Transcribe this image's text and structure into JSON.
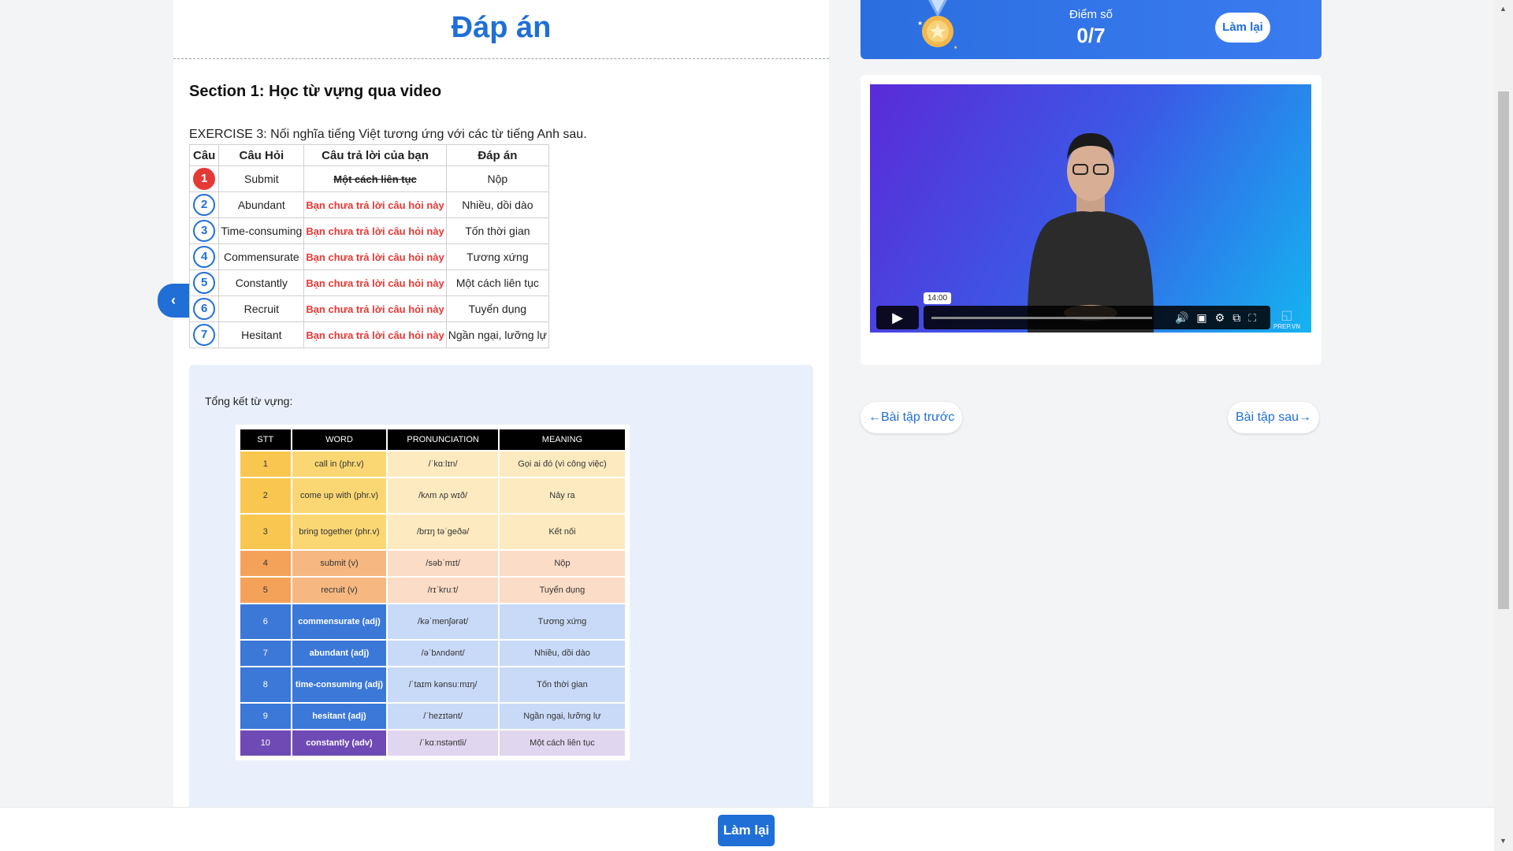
{
  "header": {
    "title": "Đáp án"
  },
  "section": {
    "title": "Section 1: Học từ vựng qua video"
  },
  "exercise": {
    "instruction": "EXERCISE 3: Nối nghĩa tiếng Việt tương ứng với các từ tiếng Anh sau.",
    "columns": [
      "Câu",
      "Câu Hỏi",
      "Câu trả lời của bạn",
      "Đáp án"
    ],
    "rows": [
      {
        "num": "1",
        "question": "Submit",
        "answer": "Một cách liên tục",
        "correct": "Nộp",
        "status": "wrong"
      },
      {
        "num": "2",
        "question": "Abundant",
        "answer": "Bạn chưa trả lời câu hỏi này",
        "correct": "Nhiều, dồi dào",
        "status": "unanswered"
      },
      {
        "num": "3",
        "question": "Time-consuming",
        "answer": "Bạn chưa trả lời câu hỏi này",
        "correct": "Tốn thời gian",
        "status": "unanswered"
      },
      {
        "num": "4",
        "question": "Commensurate",
        "answer": "Bạn chưa trả lời câu hỏi này",
        "correct": "Tương xứng",
        "status": "unanswered"
      },
      {
        "num": "5",
        "question": "Constantly",
        "answer": "Bạn chưa trả lời câu hỏi này",
        "correct": "Một cách liên tục",
        "status": "unanswered"
      },
      {
        "num": "6",
        "question": "Recruit",
        "answer": "Bạn chưa trả lời câu hỏi này",
        "correct": "Tuyển dụng",
        "status": "unanswered"
      },
      {
        "num": "7",
        "question": "Hesitant",
        "answer": "Bạn chưa trả lời câu hỏi này",
        "correct": "Ngần ngại, lưỡng lự",
        "status": "unanswered"
      }
    ]
  },
  "summary": {
    "title": "Tổng kết từ vựng:",
    "columns": [
      "STT",
      "WORD",
      "PRONUNCIATION",
      "MEANING"
    ],
    "rows": [
      {
        "stt": "1",
        "word": "call in (phr.v)",
        "pron": "/ˈkɑːlɪn/",
        "meaning": "Gọi ai đó (vì công việc)",
        "group": "yellow"
      },
      {
        "stt": "2",
        "word": "come up with (phr.v)",
        "pron": "/kʌm ʌp wɪð/",
        "meaning": "Nảy ra",
        "group": "yellow"
      },
      {
        "stt": "3",
        "word": "bring together (phr.v)",
        "pron": "/brɪŋ təˈgeðə/",
        "meaning": "Kết nối",
        "group": "yellow"
      },
      {
        "stt": "4",
        "word": "submit (v)",
        "pron": "/səbˈmɪt/",
        "meaning": "Nộp",
        "group": "orange"
      },
      {
        "stt": "5",
        "word": "recruit (v)",
        "pron": "/rɪˈkruːt/",
        "meaning": "Tuyển dụng",
        "group": "orange"
      },
      {
        "stt": "6",
        "word": "commensurate (adj)",
        "pron": "/kəˈmenʃərət/",
        "meaning": "Tương xứng",
        "group": "blue"
      },
      {
        "stt": "7",
        "word": "abundant (adj)",
        "pron": "/əˈbʌndənt/",
        "meaning": "Nhiều, dồi dào",
        "group": "blue"
      },
      {
        "stt": "8",
        "word": "time-consuming (adj)",
        "pron": "/ˈtaɪm kənsuːmɪŋ/",
        "meaning": "Tốn thời gian",
        "group": "blue"
      },
      {
        "stt": "9",
        "word": "hesitant (adj)",
        "pron": "/ˈhezɪtənt/",
        "meaning": "Ngần ngại, lưỡng lự",
        "group": "blue"
      },
      {
        "stt": "10",
        "word": "constantly (adv)",
        "pron": "/ˈkɑːnstəntli/",
        "meaning": "Một cách liên tục",
        "group": "purple"
      }
    ],
    "group_colors": {
      "yellow": [
        "#f9c74f",
        "#fbd774",
        "#fdeac0"
      ],
      "orange": [
        "#f4a259",
        "#f6b880",
        "#fbdcc6"
      ],
      "blue": [
        "#3b78d8",
        "#3b78d8",
        "#c9daf8"
      ],
      "purple": [
        "#6f4ab5",
        "#6f4ab5",
        "#e0d6f0"
      ]
    }
  },
  "score": {
    "label": "Điểm số",
    "value": "0/7",
    "retry_label": "Làm lại"
  },
  "video": {
    "time_tooltip": "14:00",
    "logo": "PREP.VN"
  },
  "nav": {
    "prev_label": "←Bài tập trước",
    "next_label": "Bài tập sau→"
  },
  "bottom": {
    "retry_label": "Làm lại"
  },
  "colors": {
    "accent": "#1f6fd6",
    "error": "#e53935",
    "summary_bg": "#eaf0fb"
  }
}
